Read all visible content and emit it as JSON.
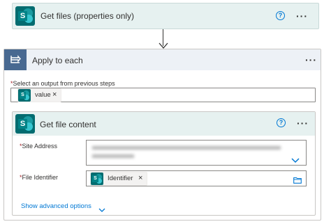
{
  "get_files": {
    "title": "Get files (properties only)",
    "connector_letter": "S",
    "help_glyph": "?",
    "menu_glyph": "···"
  },
  "apply_to_each": {
    "title": "Apply to each",
    "menu_glyph": "···",
    "output_label": "Select an output from previous steps",
    "required_mark": "*",
    "token": {
      "label": "value",
      "remove": "×"
    }
  },
  "get_file_content": {
    "title": "Get file content",
    "connector_letter": "S",
    "help_glyph": "?",
    "menu_glyph": "···",
    "site_address_label": "Site Address",
    "file_identifier_label": "File Identifier",
    "required_mark": "*",
    "identifier_token": {
      "label": "Identifier",
      "remove": "×"
    },
    "show_advanced_label": "Show advanced options"
  },
  "colors": {
    "accent": "#0078d4",
    "sharepoint_teal": "#036c70",
    "header_bg": "#e6f1f0",
    "loop_header_bg": "#edf1f6",
    "loop_icon_bg": "#486991"
  }
}
